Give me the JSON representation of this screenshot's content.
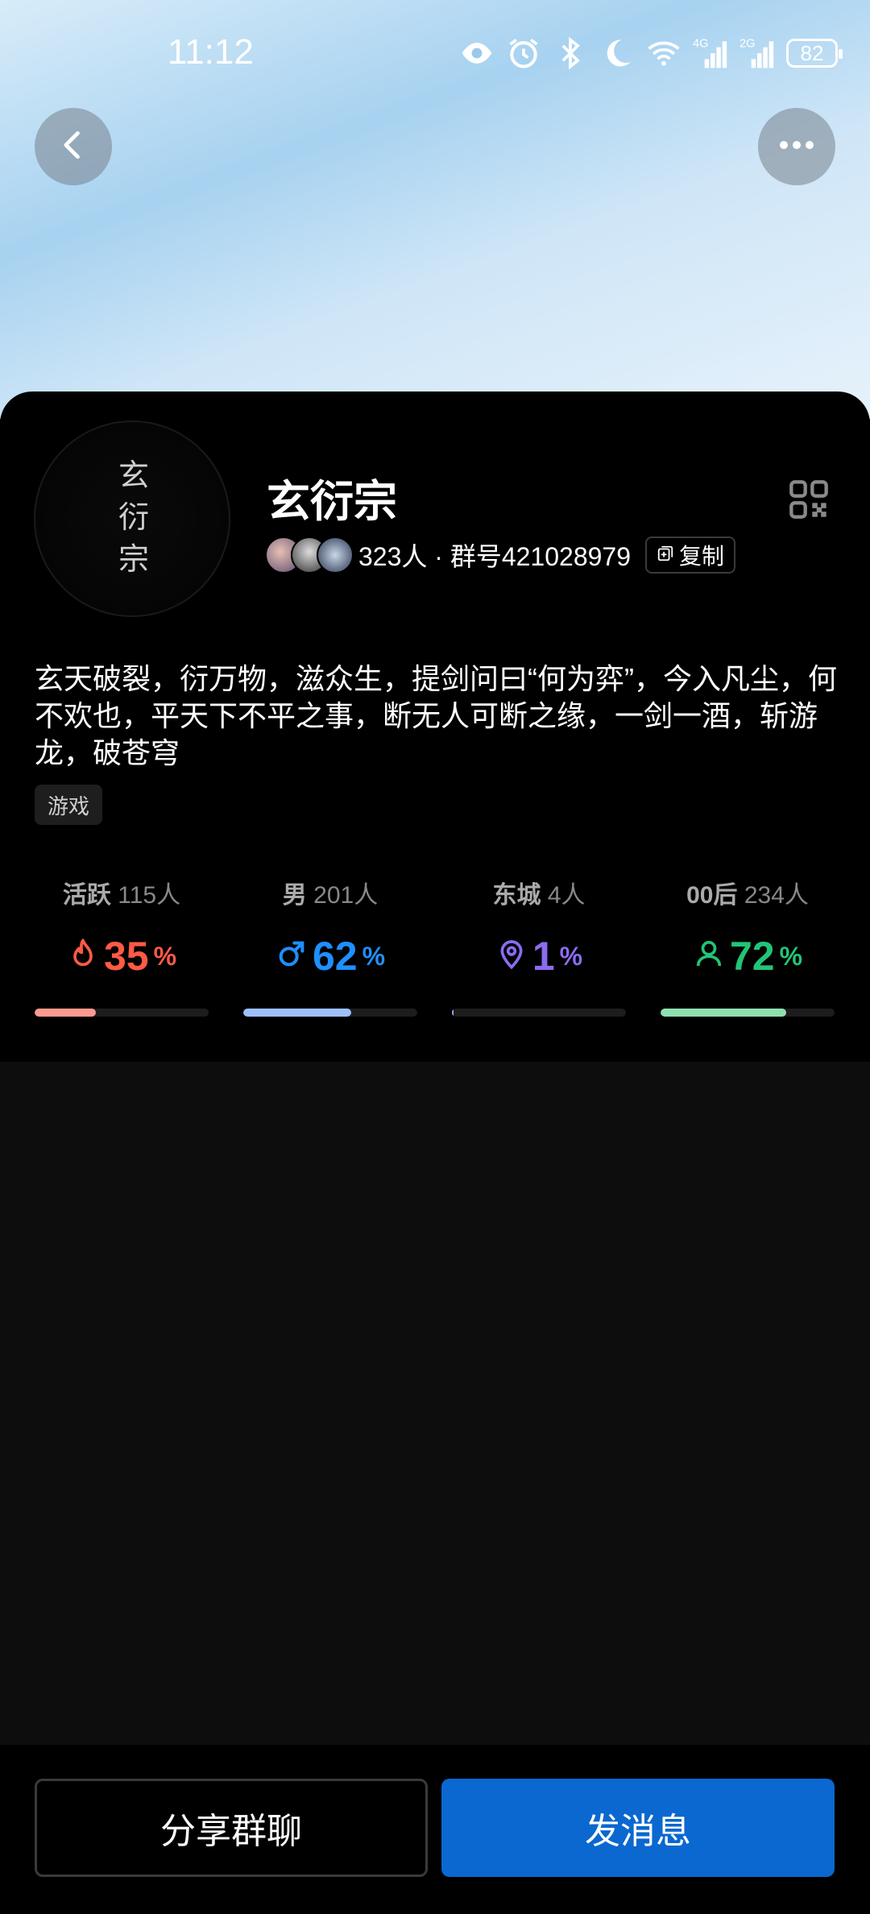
{
  "status_bar": {
    "time": "11:12",
    "icons": [
      "eye-icon",
      "alarm-icon",
      "bluetooth-icon",
      "moon-icon",
      "wifi-icon",
      "signal-4g-icon",
      "signal-2g-icon"
    ],
    "battery": "82"
  },
  "header": {
    "back_icon": "chevron-left-icon",
    "more_icon": "more-dots-icon"
  },
  "group": {
    "avatar_text": "玄\n衍\n宗",
    "name": "玄衍宗",
    "members_text": "323人 · 群号421028979",
    "copy_label": "复制",
    "description": "玄天破裂，衍万物，滋众生，提剑问曰“何为弈”，今入凡尘，何不欢也，平天下不平之事，断无人可断之缘，一剑一酒，斩游龙，破苍穹",
    "tag": "游戏"
  },
  "stats": [
    {
      "label": "活跃",
      "count": "115人",
      "value": "35",
      "unit": "%",
      "icon": "flame-icon",
      "color": "#ff5a45",
      "bar_color": "#ff9a8f",
      "fraction": 0.35
    },
    {
      "label": "男",
      "count": "201人",
      "value": "62",
      "unit": "%",
      "icon": "male-icon",
      "color": "#1e90ff",
      "bar_color": "#9ec0ff",
      "fraction": 0.62
    },
    {
      "label": "东城",
      "count": "4人",
      "value": "1",
      "unit": "%",
      "icon": "location-icon",
      "color": "#8b6cf0",
      "bar_color": "#b8a8ff",
      "fraction": 0.01
    },
    {
      "label": "00后",
      "count": "234人",
      "value": "72",
      "unit": "%",
      "icon": "person-icon",
      "color": "#22c576",
      "bar_color": "#8fe0b0",
      "fraction": 0.72
    }
  ],
  "actions": {
    "share_label": "分享群聊",
    "message_label": "发消息"
  }
}
